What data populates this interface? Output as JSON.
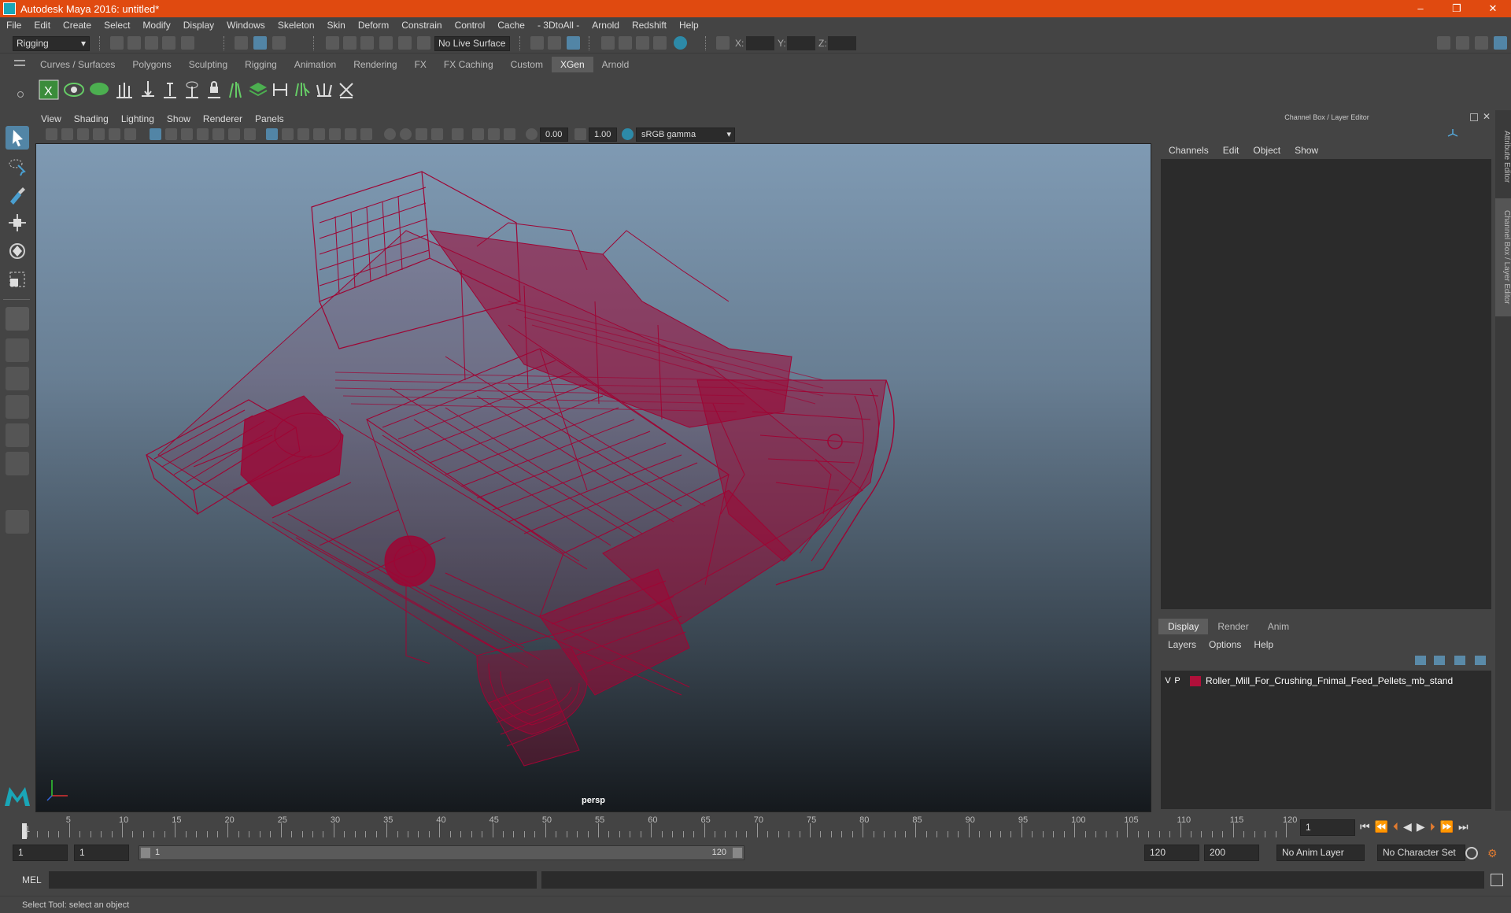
{
  "window": {
    "title": "Autodesk Maya 2016: untitled*",
    "minimize": "–",
    "restore": "❐",
    "close": "✕"
  },
  "menu": [
    "File",
    "Edit",
    "Create",
    "Select",
    "Modify",
    "Display",
    "Windows",
    "Skeleton",
    "Skin",
    "Deform",
    "Constrain",
    "Control",
    "Cache",
    "- 3DtoAll -",
    "Arnold",
    "Redshift",
    "Help"
  ],
  "statusline": {
    "mode": "Rigging",
    "live_surface": "No Live Surface",
    "x_label": "X:",
    "y_label": "Y:",
    "z_label": "Z:"
  },
  "shelf": {
    "tabs": [
      "Curves / Surfaces",
      "Polygons",
      "Sculpting",
      "Rigging",
      "Animation",
      "Rendering",
      "FX",
      "FX Caching",
      "Custom",
      "XGen",
      "Arnold"
    ],
    "active": "XGen"
  },
  "viewport": {
    "menu": [
      "View",
      "Shading",
      "Lighting",
      "Show",
      "Renderer",
      "Panels"
    ],
    "exposure": "0.00",
    "gamma": "1.00",
    "color_space": "sRGB gamma",
    "camera": "persp",
    "wire_color": "#9e0534",
    "bg_top": "#7f9ab3",
    "bg_bottom": "#15191d"
  },
  "channel_box": {
    "title": "Channel Box / Layer Editor",
    "menu": [
      "Channels",
      "Edit",
      "Object",
      "Show"
    ]
  },
  "side_tabs": [
    "Attribute Editor",
    "Channel Box / Layer Editor"
  ],
  "layer_editor": {
    "tabs": [
      "Display",
      "Render",
      "Anim"
    ],
    "active": "Display",
    "menu": [
      "Layers",
      "Options",
      "Help"
    ],
    "layers": [
      {
        "v": "V",
        "p": "P",
        "color": "#b0103a",
        "name": "Roller_Mill_For_Crushing_Fnimal_Feed_Pellets_mb_stand"
      }
    ]
  },
  "timeline": {
    "labels": [
      "1",
      "5",
      "10",
      "15",
      "20",
      "25",
      "30",
      "35",
      "40",
      "45",
      "50",
      "55",
      "60",
      "65",
      "70",
      "75",
      "80",
      "85",
      "90",
      "95",
      "100",
      "105",
      "110",
      "115",
      "120"
    ],
    "current_frame": "1"
  },
  "range": {
    "start": "1",
    "anim_start": "1",
    "slider_start": "1",
    "slider_end": "120",
    "anim_end": "120",
    "end": "200",
    "anim_layer": "No Anim Layer",
    "character_set": "No Character Set"
  },
  "command": {
    "label": "MEL"
  },
  "help_line": "Select Tool: select an object"
}
